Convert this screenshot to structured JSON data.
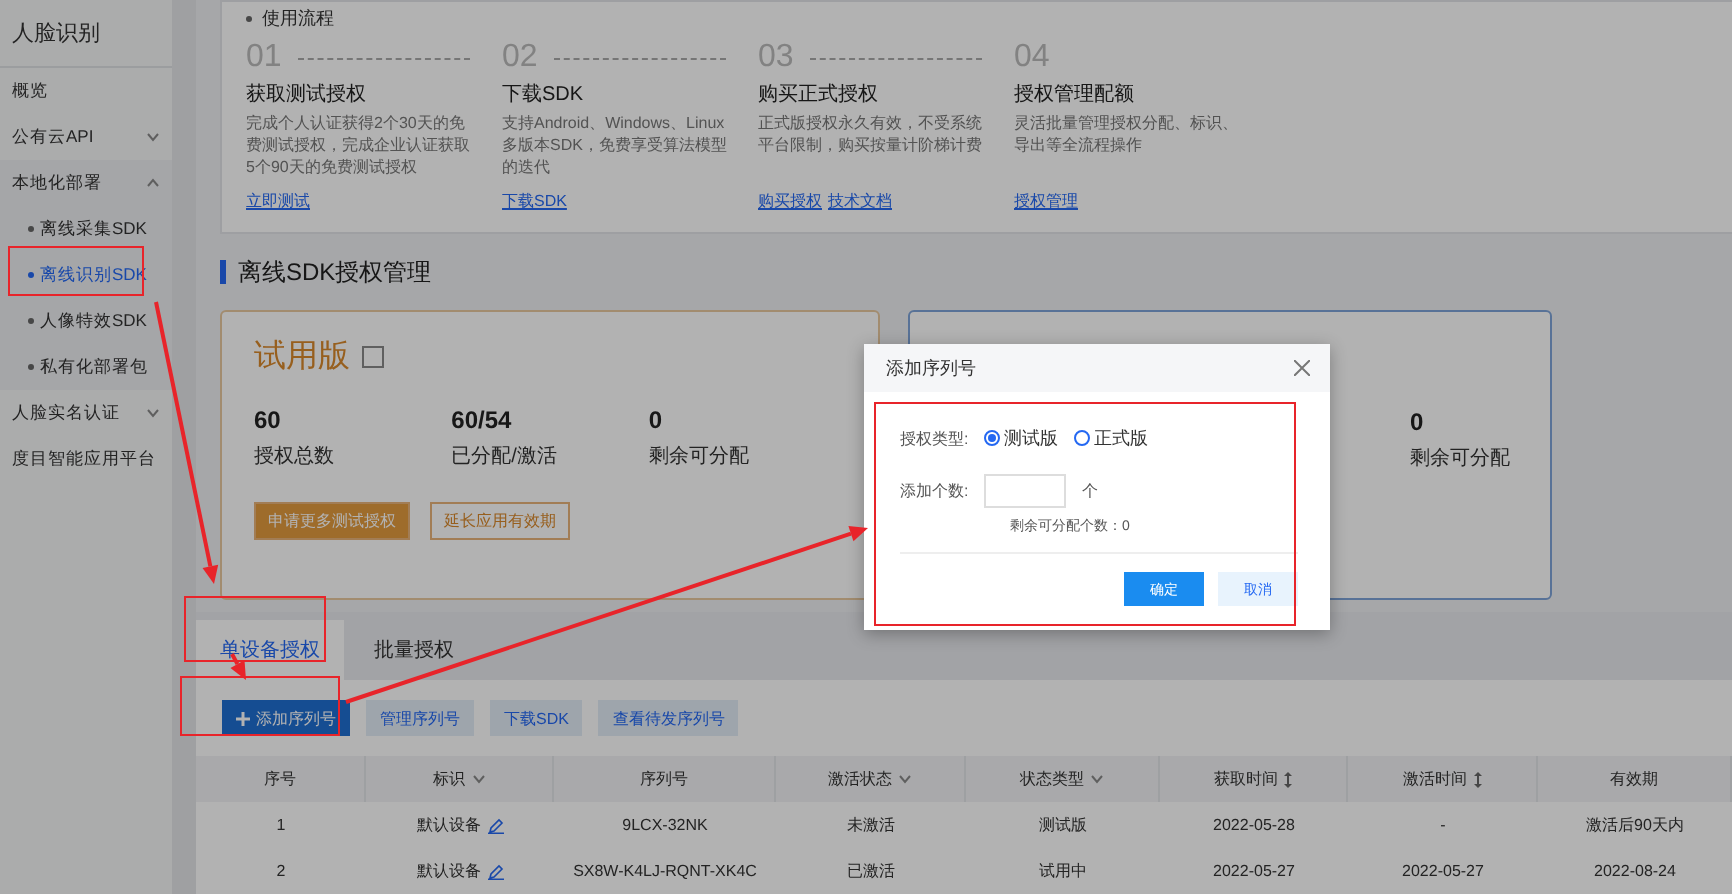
{
  "sidebar": {
    "title": "人脸识别",
    "items": [
      {
        "label": "概览",
        "kind": "link"
      },
      {
        "label": "公有云API",
        "kind": "group",
        "expanded": false
      },
      {
        "label": "本地化部署",
        "kind": "group",
        "expanded": true,
        "children": [
          {
            "label": "离线采集SDK",
            "selected": false
          },
          {
            "label": "离线识别SDK",
            "selected": true
          },
          {
            "label": "人像特效SDK",
            "selected": false
          },
          {
            "label": "私有化部署包",
            "selected": false
          }
        ]
      },
      {
        "label": "人脸实名认证",
        "kind": "group",
        "expanded": false
      },
      {
        "label": "度目智能应用平台",
        "kind": "link"
      }
    ]
  },
  "process": {
    "title": "使用流程",
    "steps": [
      {
        "number": "01",
        "title": "获取测试授权",
        "text": "完成个人认证获得2个30天的免费测试授权，完成企业认证获取5个90天的免费测试授权",
        "links": [
          "立即测试"
        ]
      },
      {
        "number": "02",
        "title": "下载SDK",
        "text": "支持Android、Windows、Linux多版本SDK，免费享受算法模型的迭代",
        "links": [
          "下载SDK"
        ]
      },
      {
        "number": "03",
        "title": "购买正式授权",
        "text": "正式版授权永久有效，不受系统平台限制，购买按量计阶梯计费",
        "links": [
          "购买授权",
          "技术文档"
        ]
      },
      {
        "number": "04",
        "title": "授权管理配额",
        "text": "灵活批量管理授权分配、标识、导出等全流程操作",
        "links": [
          "授权管理"
        ]
      }
    ]
  },
  "license_section": {
    "title": "离线SDK授权管理",
    "trial": {
      "title": "试用版",
      "stats": [
        {
          "value": "60",
          "label": "授权总数"
        },
        {
          "value": "60/54",
          "label": "已分配/激活"
        },
        {
          "value": "0",
          "label": "剩余可分配"
        }
      ],
      "buttons": [
        "申请更多测试授权",
        "延长应用有效期"
      ]
    },
    "formal": {
      "stats": [
        {
          "value": "0",
          "label": "剩余可分配"
        }
      ]
    }
  },
  "tabs": [
    {
      "label": "单设备授权",
      "selected": true
    },
    {
      "label": "批量授权",
      "selected": false
    }
  ],
  "toolbar": [
    {
      "label": "添加序列号",
      "kind": "primary"
    },
    {
      "label": "管理序列号",
      "kind": "secondary"
    },
    {
      "label": "下载SDK",
      "kind": "secondary"
    },
    {
      "label": "查看待发序列号",
      "kind": "secondary"
    }
  ],
  "table": {
    "columns": [
      {
        "label": "序号",
        "kind": "plain"
      },
      {
        "label": "标识",
        "kind": "filter"
      },
      {
        "label": "序列号",
        "kind": "plain"
      },
      {
        "label": "激活状态",
        "kind": "filter"
      },
      {
        "label": "状态类型",
        "kind": "filter"
      },
      {
        "label": "获取时间",
        "kind": "sort"
      },
      {
        "label": "激活时间",
        "kind": "sort"
      },
      {
        "label": "有效期",
        "kind": "plain"
      }
    ],
    "rows": [
      {
        "index": "1",
        "tag": "默认设备",
        "serial": "9LCX-32NK",
        "status": "未激活",
        "type": "测试版",
        "obtained": "2022-05-28",
        "activated": "-",
        "validity": "激活后90天内"
      },
      {
        "index": "2",
        "tag": "默认设备",
        "serial": "SX8W-K4LJ-RQNT-XK4C",
        "status": "已激活",
        "type": "试用中",
        "obtained": "2022-05-27",
        "activated": "2022-05-27",
        "validity": "2022-08-24"
      }
    ]
  },
  "dialog": {
    "title": "添加序列号",
    "type_label": "授权类型:",
    "options": [
      {
        "label": "测试版",
        "selected": true
      },
      {
        "label": "正式版",
        "selected": false
      }
    ],
    "count_label": "添加个数:",
    "unit": "个",
    "hint": "剩余可分配个数：0",
    "buttons": [
      {
        "label": "确定",
        "kind": "primary"
      },
      {
        "label": "取消",
        "kind": "secondary"
      }
    ]
  }
}
